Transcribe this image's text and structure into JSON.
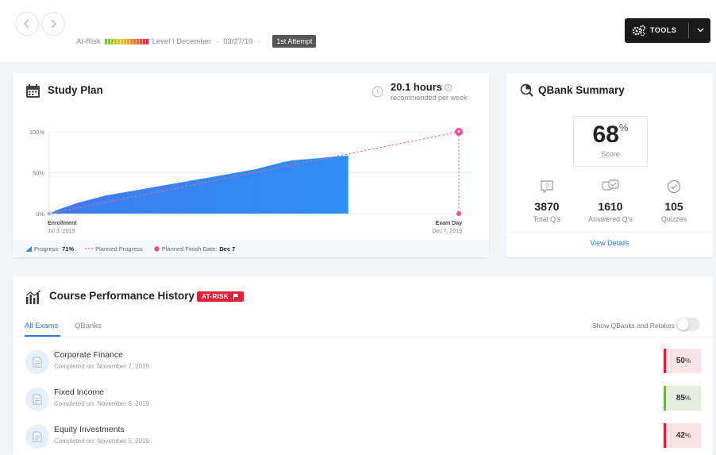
{
  "header": {
    "risk_label": "At-Risk",
    "risk_colors": [
      "#7bbf3b",
      "#7bbf3b",
      "#9dc23a",
      "#b8c43a",
      "#cfc33a",
      "#e2b93a",
      "#ebac3a",
      "#f19b3a",
      "#f08a3a",
      "#ee763c",
      "#ec613e",
      "#e84a40",
      "#e23542",
      "#dd2244"
    ],
    "level": "Level I December",
    "date": "03/27/19",
    "attempt": "1st Attempt",
    "tools_label": "TOOLS"
  },
  "study_plan": {
    "title": "Study Plan",
    "hours": "20.1 hours",
    "hours_sub": "recommended per week",
    "legend": {
      "progress_label": "Progress:",
      "progress_value": "71%",
      "planned_label": "Planned Progress",
      "finish_label": "Planned Finish Date:",
      "finish_value": "Dec 7"
    },
    "colors": {
      "actual": "#2d8cf0",
      "planned": "#f0609e"
    }
  },
  "chart_data": {
    "type": "area",
    "y_ticks": [
      "100%",
      "50%",
      "0%"
    ],
    "ylim": [
      0,
      100
    ],
    "x_start_label": "Enrollment",
    "x_start_date": "Jul 3, 2019",
    "x_end_label": "Exam Day",
    "x_end_date": "Dec 7, 2019",
    "actual_progress_curve": [
      0,
      5,
      9,
      13,
      16,
      19,
      22,
      24,
      26,
      28,
      30,
      32,
      34,
      36,
      38,
      40,
      42,
      44,
      46,
      48,
      50,
      52,
      54,
      57,
      60,
      63,
      65,
      66,
      67,
      68,
      69,
      70,
      71
    ],
    "actual_progress_fraction_of_timeline": 0.73,
    "planned_progress": [
      0,
      100
    ]
  },
  "qbank": {
    "title": "QBank Summary",
    "score": "68",
    "score_pct": "%",
    "score_label": "Score",
    "stats": [
      {
        "value": "3870",
        "label": "Total Q's",
        "icon": "question-bubble-icon"
      },
      {
        "value": "1610",
        "label": "Answered Q's",
        "icon": "answered-bubbles-icon"
      },
      {
        "value": "105",
        "label": "Quizzes",
        "icon": "check-circle-icon"
      }
    ],
    "view_details": "View Details"
  },
  "performance": {
    "title": "Course Performance History",
    "badge": "AT-RISK",
    "tabs": [
      "All Exams",
      "QBanks"
    ],
    "toggle_label": "Show QBanks and Retakes",
    "rows": [
      {
        "name": "Corporate Finance",
        "date": "Completed on: November 7, 2019",
        "score": "50",
        "unit": "%",
        "status": "low"
      },
      {
        "name": "Fixed Income",
        "date": "Completed on: November 6, 2019",
        "score": "85",
        "unit": "%",
        "status": "high"
      },
      {
        "name": "Equity Investments",
        "date": "Completed on: November 5, 2019",
        "score": "42",
        "unit": "%",
        "status": "low"
      }
    ]
  }
}
